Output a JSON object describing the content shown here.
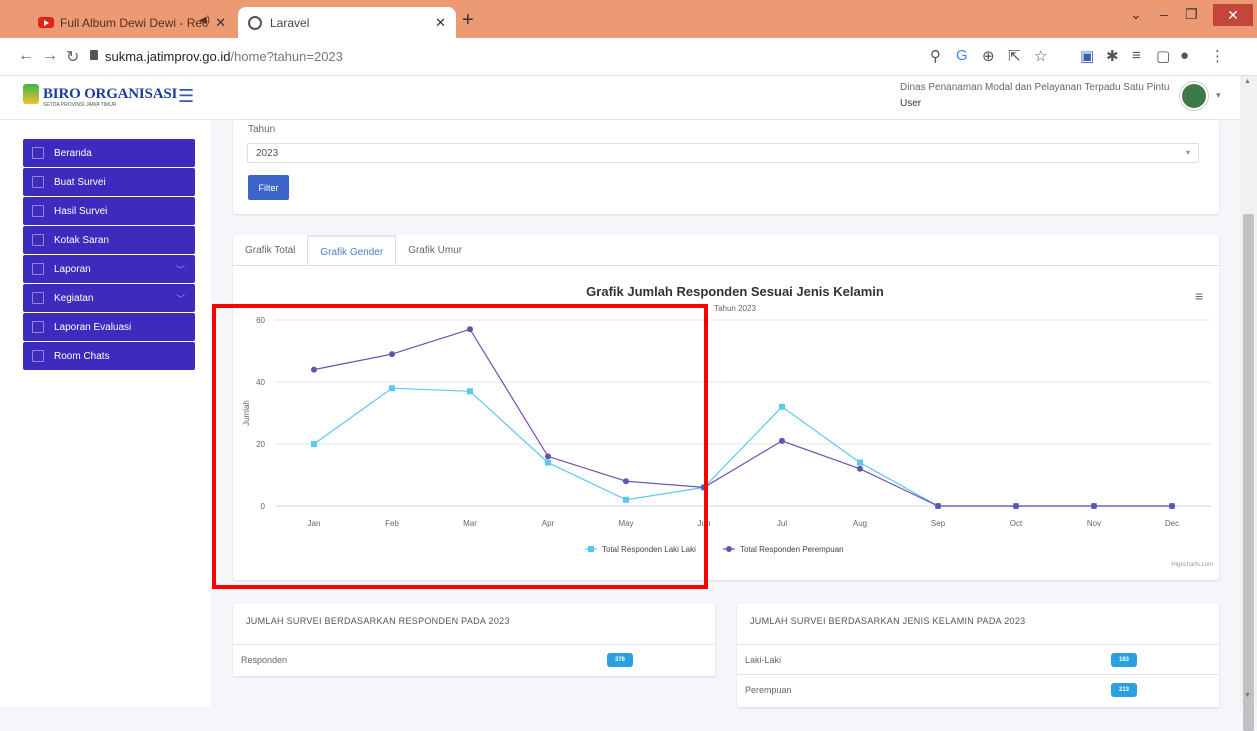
{
  "browser": {
    "tabs": [
      {
        "title": "Full Album Dewi Dewi - Rec"
      },
      {
        "title": "Laravel"
      }
    ],
    "url_host": "sukma.jatimprov.go.id",
    "url_path": "/home?tahun=2023"
  },
  "header": {
    "logo_title": "BIRO ORGANISASI",
    "logo_subtitle": "SETDA PROVINSI JAWA TIMUR",
    "instansi": "Dinas Penanaman Modal dan Pelayanan Terpadu Satu Pintu",
    "user_role": "User"
  },
  "sidebar": {
    "items": [
      {
        "label": "Beranda"
      },
      {
        "label": "Buat Survei"
      },
      {
        "label": "Hasil Survei"
      },
      {
        "label": "Kotak Saran"
      },
      {
        "label": "Laporan"
      },
      {
        "label": "Kegiatan"
      },
      {
        "label": "Laporan Evaluasi"
      },
      {
        "label": "Room Chats"
      }
    ]
  },
  "filter": {
    "label": "Tahun",
    "selected": "2023",
    "button": "Filter"
  },
  "chart_tabs": [
    "Grafik Total",
    "Grafik Gender",
    "Grafik Umur"
  ],
  "chart_data": {
    "type": "line",
    "title": "Grafik Jumlah Responden Sesuai Jenis Kelamin",
    "subtitle": "Tahun 2023",
    "ylabel": "Jumlah",
    "ylim": [
      0,
      60
    ],
    "yticks": [
      0,
      20,
      40,
      60
    ],
    "categories": [
      "Jan",
      "Feb",
      "Mar",
      "Apr",
      "May",
      "Jun",
      "Jul",
      "Aug",
      "Sep",
      "Oct",
      "Nov",
      "Dec"
    ],
    "series": [
      {
        "name": "Total Responden Laki Laki",
        "color": "#5bc8f0",
        "marker": "square",
        "values": [
          20,
          38,
          37,
          14,
          2,
          6,
          32,
          14,
          0,
          0,
          0,
          0
        ]
      },
      {
        "name": "Total Responden Perempuan",
        "color": "#6a4fb3",
        "marker": "circle",
        "values": [
          44,
          49,
          57,
          16,
          8,
          6,
          21,
          12,
          0,
          0,
          0,
          0
        ]
      }
    ],
    "credit": "Highcharts.com"
  },
  "stats": {
    "responden": {
      "title": "JUMLAH SURVEI BERDASARKAN RESPONDEN PADA 2023",
      "rows": [
        {
          "label": "Responden",
          "value": "376"
        }
      ]
    },
    "gender": {
      "title": "JUMLAH SURVEI BERDASARKAN JENIS KELAMIN PADA 2023",
      "rows": [
        {
          "label": "Laki-Laki",
          "value": "163"
        },
        {
          "label": "Perempuan",
          "value": "213"
        }
      ]
    }
  }
}
